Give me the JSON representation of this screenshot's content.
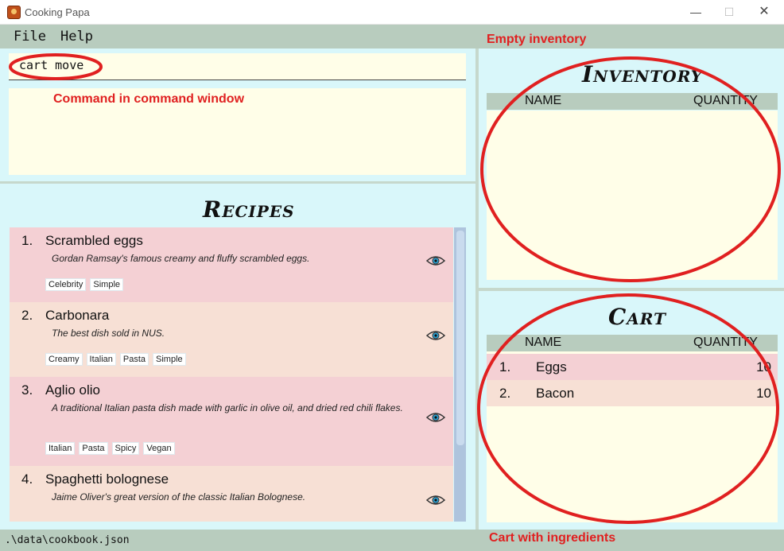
{
  "window": {
    "title": "Cooking Papa",
    "minimize_glyph": "—",
    "maximize_glyph": "☐",
    "close_glyph": "✕"
  },
  "menu": {
    "file": "File",
    "help": "Help"
  },
  "command": {
    "value": "cart move"
  },
  "recipes": {
    "title": "Recipes",
    "items": [
      {
        "index": "1.",
        "name": "Scrambled eggs",
        "description": "Gordan Ramsay's famous creamy and fluffy scrambled eggs.",
        "tags": [
          "Celebrity",
          "Simple"
        ]
      },
      {
        "index": "2.",
        "name": "Carbonara",
        "description": "The best dish sold in NUS.",
        "tags": [
          "Creamy",
          "Italian",
          "Pasta",
          "Simple"
        ]
      },
      {
        "index": "3.",
        "name": "Aglio olio",
        "description": "A traditional Italian pasta dish made with garlic in olive oil, and dried red chili flakes.",
        "tags": [
          "Italian",
          "Pasta",
          "Spicy",
          "Vegan"
        ]
      },
      {
        "index": "4.",
        "name": "Spaghetti bolognese",
        "description": "Jaime Oliver's great version of the classic Italian Bolognese.",
        "tags": []
      }
    ]
  },
  "inventory": {
    "title": "Inventory",
    "col_name": "NAME",
    "col_qty": "QUANTITY"
  },
  "cart": {
    "title": "Cart",
    "col_name": "NAME",
    "col_qty": "QUANTITY",
    "rows": [
      {
        "index": "1.",
        "name": "Eggs",
        "qty": "10"
      },
      {
        "index": "2.",
        "name": "Bacon",
        "qty": "10"
      }
    ]
  },
  "status": {
    "path": ".\\data\\cookbook.json"
  },
  "annotations": {
    "empty_inventory": "Empty inventory",
    "command_window": "Command in command window",
    "cart_ingredients": "Cart with ingredients",
    "color": "#e02020"
  },
  "colors": {
    "panel": "#d9f7fa",
    "cream": "#fffee8",
    "menu": "#b8ccbe",
    "row_odd": "#f4d0d4",
    "row_even": "#f7e0d5"
  }
}
